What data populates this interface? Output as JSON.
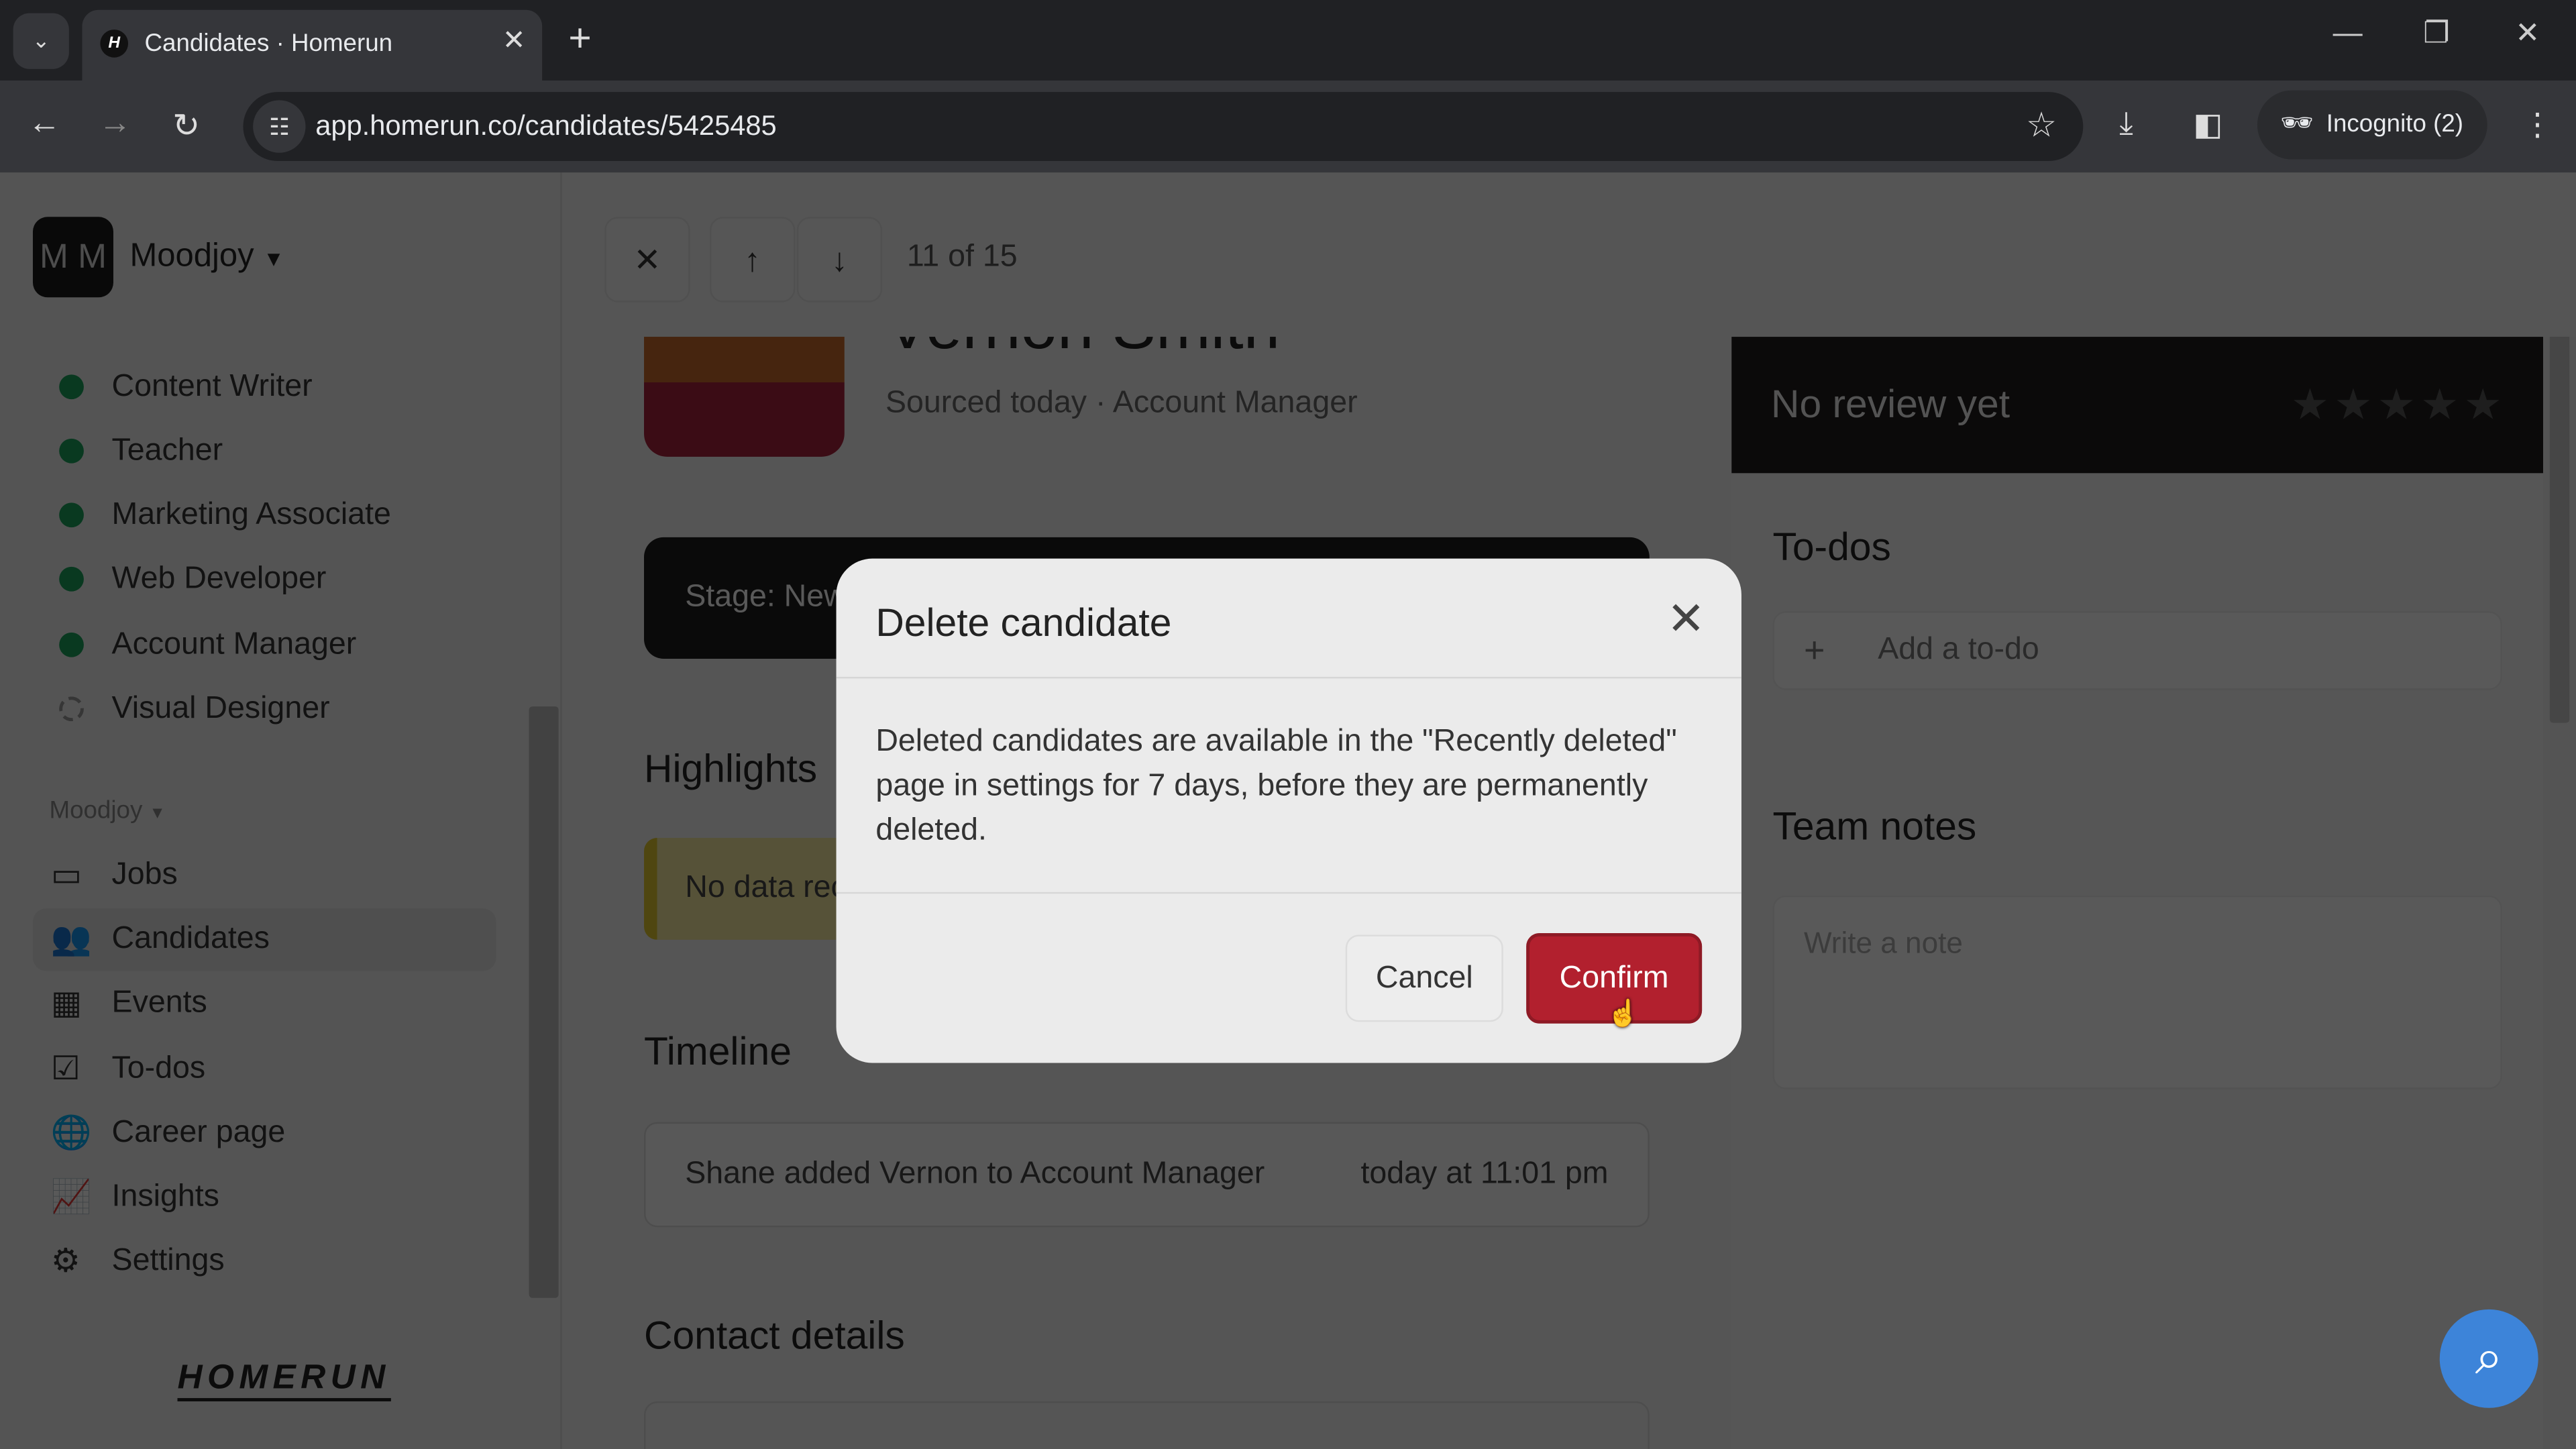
{
  "browser": {
    "tab_title": "Candidates · Homerun",
    "url": "app.homerun.co/candidates/5425485",
    "profile": "Incognito (2)"
  },
  "sidebar": {
    "org_initials": "M M",
    "org_name": "Moodjoy",
    "jobs": [
      {
        "label": "Content Writer",
        "status": "active"
      },
      {
        "label": "Teacher",
        "status": "active"
      },
      {
        "label": "Marketing Associate",
        "status": "active"
      },
      {
        "label": "Web Developer",
        "status": "active"
      },
      {
        "label": "Account Manager",
        "status": "active"
      },
      {
        "label": "Visual Designer",
        "status": "draft"
      }
    ],
    "section_label": "Moodjoy",
    "nav": [
      {
        "label": "Jobs",
        "icon": "briefcase-icon"
      },
      {
        "label": "Candidates",
        "icon": "users-icon",
        "active": true
      },
      {
        "label": "Events",
        "icon": "calendar-icon"
      },
      {
        "label": "To-dos",
        "icon": "checkbox-icon"
      },
      {
        "label": "Career page",
        "icon": "globe-icon"
      },
      {
        "label": "Insights",
        "icon": "chart-icon"
      },
      {
        "label": "Settings",
        "icon": "gear-icon"
      }
    ],
    "brand": "HOMERUN"
  },
  "candidate": {
    "counter": "11 of 15",
    "name": "Vernon Smith",
    "subtitle": "Sourced today · Account Manager",
    "stage": "Stage: New",
    "highlights_title": "Highlights",
    "highlights_empty": "No data received",
    "timeline_title": "Timeline",
    "timeline": [
      {
        "text": "Shane added Vernon to Account Manager",
        "time": "today at 11:01 pm"
      }
    ],
    "contact_title": "Contact details"
  },
  "right_panel": {
    "review": "No review yet",
    "rating": 0,
    "rating_max": 5,
    "todos_title": "To-dos",
    "todo_placeholder": "Add a to-do",
    "notes_title": "Team notes",
    "note_placeholder": "Write a note"
  },
  "modal": {
    "title": "Delete candidate",
    "body": "Deleted candidates are available in the \"Recently deleted\" page in settings for 7 days, before they are permanently deleted.",
    "cancel": "Cancel",
    "confirm": "Confirm"
  },
  "colors": {
    "confirm": "#b2202e",
    "active_dot": "#1aa35b",
    "help": "#3d84d9"
  }
}
